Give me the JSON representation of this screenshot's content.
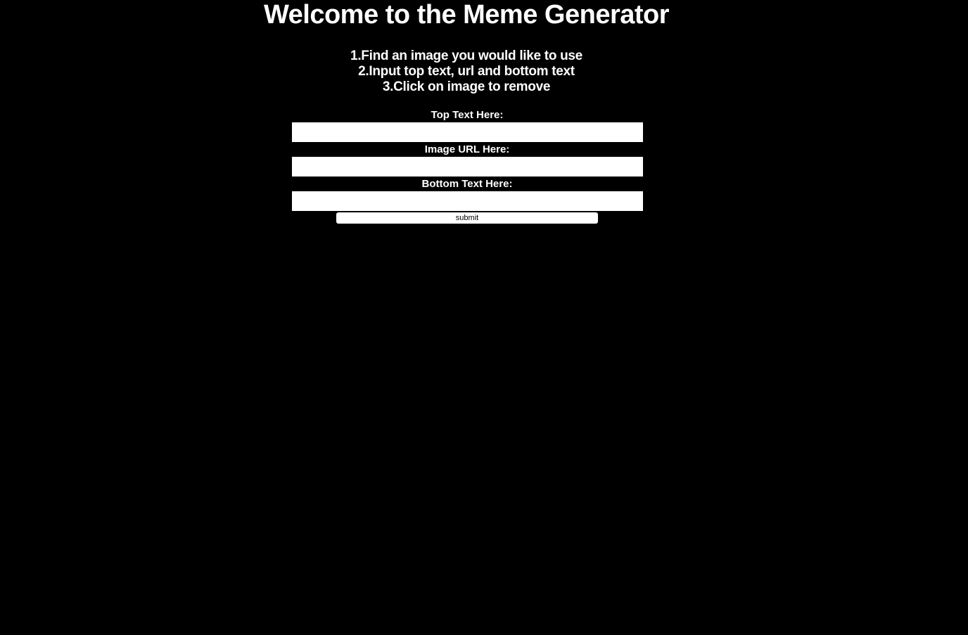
{
  "page": {
    "title": "Welcome to the Meme Generator",
    "steps": [
      "1.Find an image you would like to use",
      "2.Input top text, url and bottom text",
      "3.Click on image to remove"
    ]
  },
  "form": {
    "top_text": {
      "label": "Top Text Here:",
      "value": ""
    },
    "image_url": {
      "label": "Image URL Here:",
      "value": ""
    },
    "bottom_text": {
      "label": "Bottom Text Here:",
      "value": ""
    },
    "submit_label": "submit"
  },
  "colors": {
    "background": "#000000",
    "text": "#ffffff",
    "input_background": "#ffffff"
  }
}
